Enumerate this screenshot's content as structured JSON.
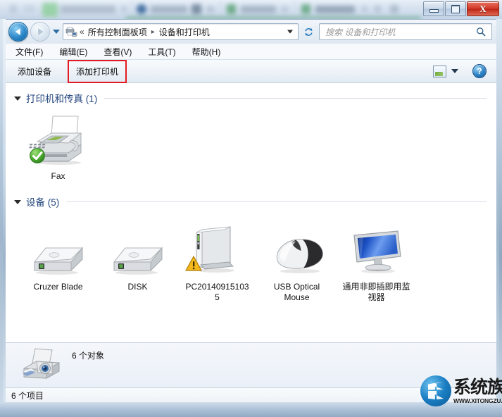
{
  "window": {
    "controls": {
      "minimize_label": "Minimize",
      "maximize_label": "Maximize",
      "close_label": "X"
    }
  },
  "addressbar": {
    "back_label": "Back",
    "forward_label": "Forward",
    "history_label": "Recent pages",
    "overflow_chevron": "«",
    "crumb1": "所有控制面板项",
    "crumb_arrow": "▸",
    "crumb2": "设备和打印机",
    "refresh_label": "Refresh",
    "icon": "devices-and-printers-icon"
  },
  "search": {
    "placeholder": "搜索 设备和打印机",
    "value": "",
    "icon": "search-icon"
  },
  "menubar": {
    "items": [
      {
        "label": "文件(F)"
      },
      {
        "label": "编辑(E)"
      },
      {
        "label": "查看(V)"
      },
      {
        "label": "工具(T)"
      },
      {
        "label": "帮助(H)"
      }
    ]
  },
  "toolbar": {
    "add_device_label": "添加设备",
    "add_printer_label": "添加打印机",
    "highlight_color": "#e31b23",
    "view_options_icon": "view-options-icon",
    "view_caret_icon": "chevron-down-icon",
    "help_label": "?"
  },
  "content": {
    "groups": [
      {
        "title": "打印机和传真 (1)",
        "items": [
          {
            "label": "Fax",
            "icon": "fax-printer-icon",
            "badge": "default-check-badge"
          }
        ]
      },
      {
        "title": "设备 (5)",
        "items": [
          {
            "label": "Cruzer Blade",
            "icon": "usb-drive-icon",
            "badge": ""
          },
          {
            "label": "DISK",
            "icon": "usb-drive-icon",
            "badge": ""
          },
          {
            "label": "PC201409151035",
            "icon": "computer-icon",
            "badge": "warning-badge"
          },
          {
            "label": "USB Optical Mouse",
            "icon": "mouse-icon",
            "badge": ""
          },
          {
            "label": "通用非即插即用监视器",
            "icon": "monitor-icon",
            "badge": ""
          }
        ]
      }
    ]
  },
  "details_pane": {
    "icon": "multifunction-device-icon",
    "text": "6 个对象"
  },
  "statusbar": {
    "text": "6 个项目"
  },
  "watermark": {
    "logo_icon": "xitongzu-globe-icon",
    "name": "系统族",
    "url": "WWW.XITONGZU.COM"
  },
  "colors": {
    "group_title": "#23467e",
    "highlight_red": "#e31b23",
    "close_button": "#bd2415",
    "accent_blue": "#2b87c9"
  }
}
